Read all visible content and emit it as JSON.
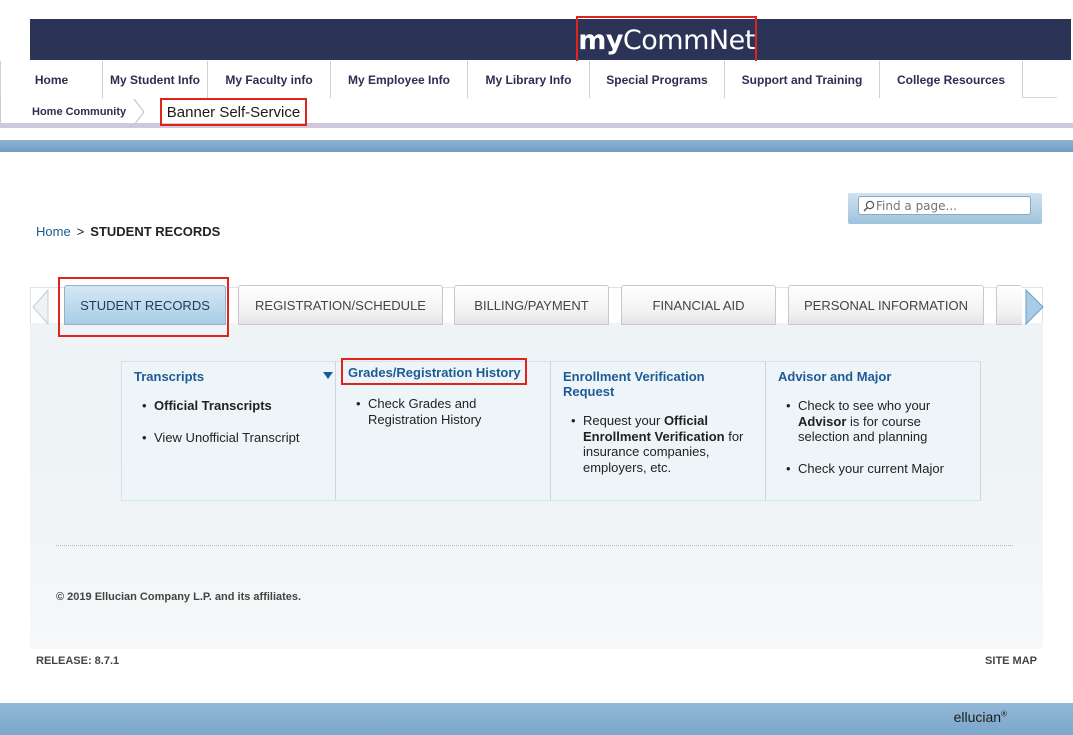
{
  "brand": {
    "part1": "my",
    "part2": "CommNet"
  },
  "nav": {
    "items": [
      {
        "label": "Home"
      },
      {
        "label": "My Student Info"
      },
      {
        "label": "My Faculty info"
      },
      {
        "label": "My Employee Info"
      },
      {
        "label": "My Library Info"
      },
      {
        "label": "Special Programs"
      },
      {
        "label": "Support and Training"
      },
      {
        "label": "College Resources"
      }
    ]
  },
  "community": {
    "home": "Home Community",
    "current": "Banner Self-Service"
  },
  "search": {
    "placeholder": "Find a page..."
  },
  "breadcrumb": {
    "home": "Home",
    "separator": ">",
    "current": "STUDENT RECORDS"
  },
  "tabs": [
    {
      "label": "STUDENT RECORDS",
      "active": true
    },
    {
      "label": "REGISTRATION/SCHEDULE"
    },
    {
      "label": "BILLING/PAYMENT"
    },
    {
      "label": "FINANCIAL AID"
    },
    {
      "label": "PERSONAL INFORMATION"
    }
  ],
  "sections": [
    {
      "title": "Transcripts",
      "items": [
        {
          "bold": "Official Transcripts"
        },
        {
          "text": "View Unofficial Transcript"
        }
      ]
    },
    {
      "title": "Grades/Registration History",
      "items": [
        {
          "text": "Check Grades and Registration History"
        }
      ]
    },
    {
      "title": "Enrollment Verification Request",
      "items": [
        {
          "pre": "Request your ",
          "bold": "Official Enrollment Verification",
          "post": " for insurance companies, employers, etc."
        }
      ]
    },
    {
      "title": "Advisor and Major",
      "items": [
        {
          "pre": "Check to see who your ",
          "bold": "Advisor",
          "post": " is for course selection and planning"
        },
        {
          "text": "Check your current Major"
        }
      ]
    }
  ],
  "copyright": "© 2019 Ellucian Company L.P. and its affiliates.",
  "release": "RELEASE: 8.7.1",
  "sitemap": "SITE MAP",
  "footer": {
    "logo": "ellucian",
    "mark": "®"
  },
  "colors": {
    "banner": "#2b3356",
    "link": "#1e5a96",
    "highlight": "#e1241b"
  }
}
